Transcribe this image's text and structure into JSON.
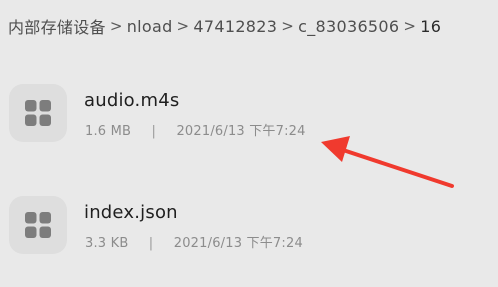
{
  "breadcrumb": {
    "items": [
      "内部存储设备",
      "nload",
      "47412823",
      "c_83036506",
      "16"
    ],
    "separator": ">"
  },
  "files": [
    {
      "name": "audio.m4s",
      "size": "1.6 MB",
      "date": "2021/6/13 下午7:24",
      "icon": "file-grid-icon"
    },
    {
      "name": "index.json",
      "size": "3.3 KB",
      "date": "2021/6/13 下午7:24",
      "icon": "file-grid-icon"
    }
  ],
  "meta_separator": "|",
  "colors": {
    "background": "#e9e9e9",
    "icon_tile": "#dedede",
    "icon_glyph": "#7d7d7d",
    "annotation": "#f03a2e"
  }
}
